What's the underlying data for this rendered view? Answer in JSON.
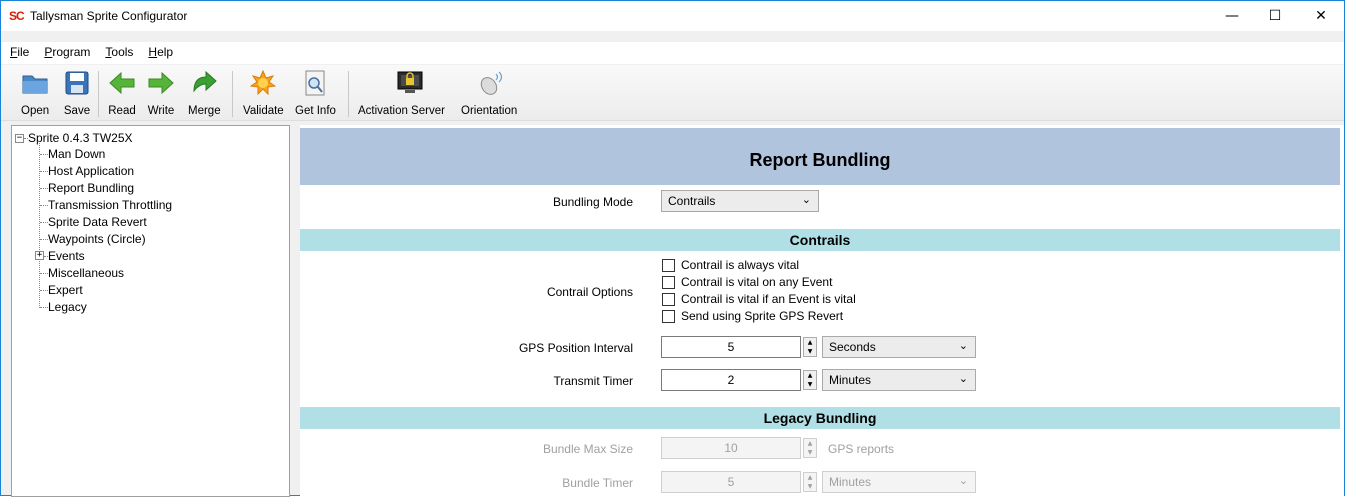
{
  "window": {
    "icon_text": "SC",
    "title": "Tallysman Sprite Configurator",
    "minimize_glyph": "—",
    "maximize_glyph": "☐",
    "close_glyph": "✕"
  },
  "menu": [
    "File",
    "Program",
    "Tools",
    "Help"
  ],
  "toolbar": {
    "open": "Open",
    "save": "Save",
    "read": "Read",
    "write": "Write",
    "merge": "Merge",
    "validate": "Validate",
    "get_info": "Get Info",
    "activation_server": "Activation Server",
    "orientation": "Orientation"
  },
  "tree": {
    "root": "Sprite 0.4.3 TW25X",
    "root_expander": "−",
    "items": [
      "Man Down",
      "Host Application",
      "Report Bundling",
      "Transmission Throttling",
      "Sprite Data Revert",
      "Waypoints (Circle)",
      "Events",
      "Miscellaneous",
      "Expert",
      "Legacy"
    ],
    "events_expander": "+"
  },
  "page": {
    "title": "Report Bundling",
    "bundling_mode_label": "Bundling Mode",
    "bundling_mode_value": "Contrails",
    "contrails_section": "Contrails",
    "contrail_options_label": "Contrail Options",
    "options": [
      {
        "label": "Contrail is always vital",
        "checked": false
      },
      {
        "label": "Contrail is vital on any Event",
        "checked": false
      },
      {
        "label": "Contrail is vital if an Event is vital",
        "checked": false
      },
      {
        "label": "Send using Sprite GPS Revert",
        "checked": false
      }
    ],
    "gps_interval_label": "GPS Position Interval",
    "gps_interval_value": "5",
    "gps_interval_unit": "Seconds",
    "transmit_timer_label": "Transmit Timer",
    "transmit_timer_value": "2",
    "transmit_timer_unit": "Minutes",
    "legacy_section": "Legacy Bundling",
    "bundle_max_label": "Bundle Max Size",
    "bundle_max_value": "10",
    "bundle_max_unit": "GPS reports",
    "bundle_timer_label": "Bundle Timer",
    "bundle_timer_value": "5",
    "bundle_timer_unit": "Minutes"
  },
  "colors": {
    "header_bg": "#b0c4de",
    "section_bg": "#b0e0e6",
    "window_border": "#1883d7"
  }
}
